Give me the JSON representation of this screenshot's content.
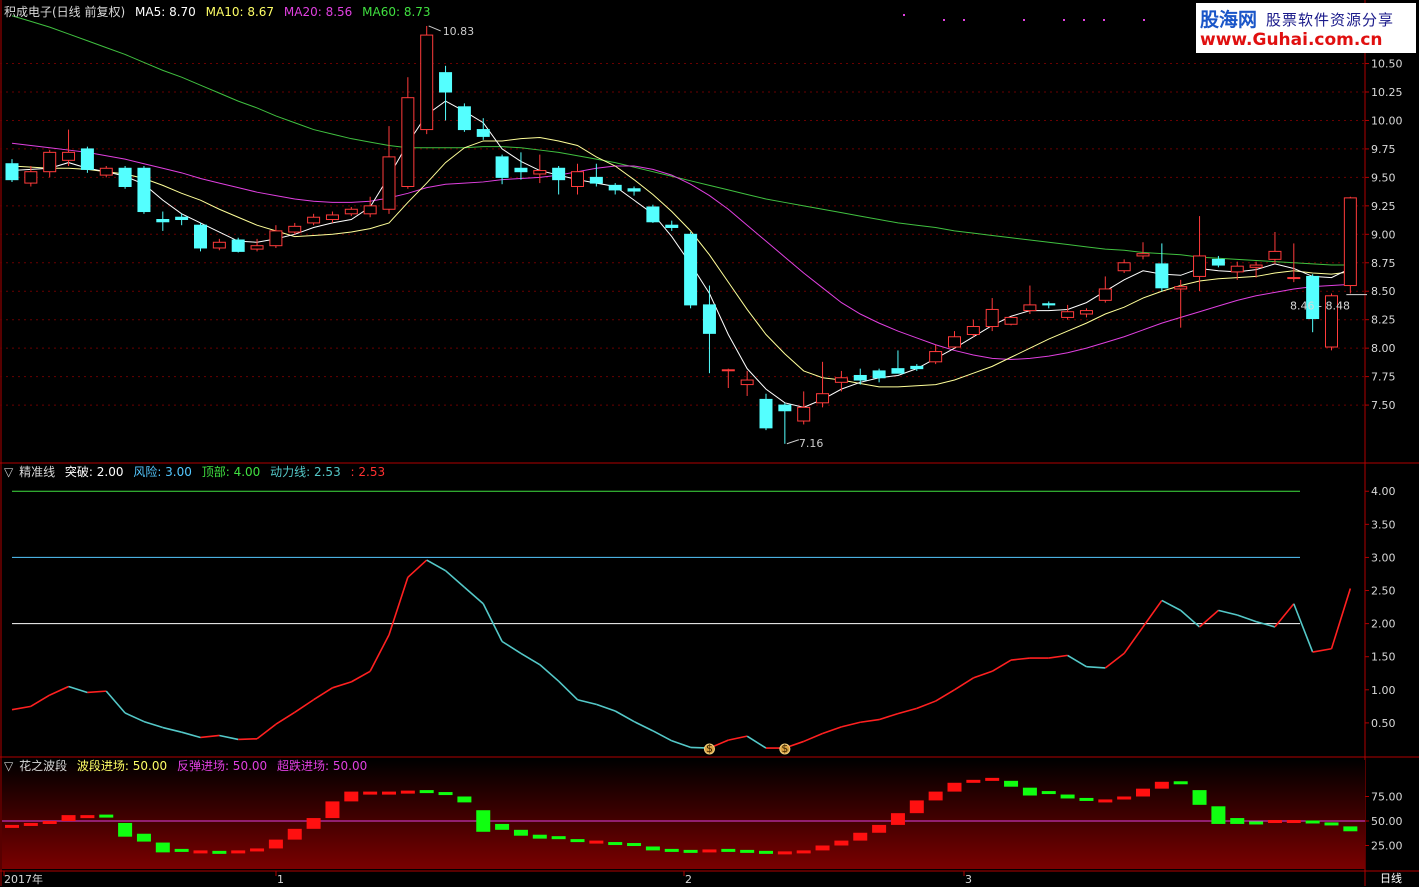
{
  "header": {
    "stock_title": "积成电子(日线 前复权)",
    "ma5_label": "MA5: 8.70",
    "ma10_label": "MA10: 8.67",
    "ma20_label": "MA20: 8.56",
    "ma60_label": "MA60: 8.73",
    "panel_marker": "▽"
  },
  "logo": {
    "line1": "股海网",
    "line1b": "股票软件资源分享",
    "line2": "www.Guhai.com.cn"
  },
  "panel2_header": {
    "name": "精准线",
    "tupo": "突破: 2.00",
    "fengxian": "风险: 3.00",
    "dingbu": "顶部: 4.00",
    "dongli": "动力线: 2.53",
    "extra": ": 2.53"
  },
  "panel3_header": {
    "name": "花之波段",
    "boduan": "波段进场: 50.00",
    "fantan": "反弹进场: 50.00",
    "chaodie": "超跌进场: 50.00"
  },
  "footer": {
    "period_label": "日线"
  },
  "annotations": {
    "high_label": "10.83",
    "low_label": "7.16",
    "price_range": "8.46 - 8.48"
  },
  "colors": {
    "up": "#ff3b3b",
    "down": "#54ffff",
    "ma5": "#ffffff",
    "ma10": "#ffff99",
    "ma20": "#e040e0",
    "ma60": "#40c040",
    "background": "#000000",
    "axis": "#b00000"
  },
  "chart_data": [
    {
      "type": "candlestick",
      "title": "积成电子(日线 前复权)",
      "y_ticks": [
        "10.50",
        "10.25",
        "10.00",
        "9.75",
        "9.50",
        "9.25",
        "9.00",
        "8.75",
        "8.50",
        "8.25",
        "8.00",
        "7.75",
        "7.50"
      ],
      "x_ticks": [
        "2017年",
        "1",
        "2",
        "3"
      ],
      "ylim": [
        7.0,
        10.9
      ],
      "candles": [
        [
          9.62,
          9.48,
          9.66,
          9.46
        ],
        [
          9.45,
          9.55,
          9.6,
          9.42
        ],
        [
          9.55,
          9.72,
          9.74,
          9.5
        ],
        [
          9.65,
          9.72,
          9.92,
          9.6
        ],
        [
          9.75,
          9.57,
          9.77,
          9.54
        ],
        [
          9.52,
          9.58,
          9.6,
          9.5
        ],
        [
          9.58,
          9.42,
          9.6,
          9.4
        ],
        [
          9.58,
          9.2,
          9.6,
          9.18
        ],
        [
          9.13,
          9.11,
          9.2,
          9.03
        ],
        [
          9.15,
          9.13,
          9.18,
          9.08
        ],
        [
          9.08,
          8.88,
          9.1,
          8.85
        ],
        [
          8.88,
          8.93,
          8.96,
          8.86
        ],
        [
          8.95,
          8.85,
          8.97,
          8.84
        ],
        [
          8.87,
          8.9,
          8.96,
          8.85
        ],
        [
          8.9,
          9.03,
          9.08,
          8.88
        ],
        [
          9.02,
          9.07,
          9.1,
          9.0
        ],
        [
          9.1,
          9.15,
          9.18,
          9.08
        ],
        [
          9.13,
          9.17,
          9.2,
          9.1
        ],
        [
          9.18,
          9.22,
          9.24,
          9.16
        ],
        [
          9.18,
          9.25,
          9.33,
          9.15
        ],
        [
          9.22,
          9.68,
          9.95,
          9.18
        ],
        [
          9.42,
          10.2,
          10.38,
          9.4
        ],
        [
          9.92,
          10.75,
          10.83,
          9.88
        ],
        [
          10.42,
          10.25,
          10.48,
          10.0
        ],
        [
          10.12,
          9.92,
          10.15,
          9.9
        ],
        [
          9.92,
          9.86,
          10.02,
          9.83
        ],
        [
          9.68,
          9.5,
          9.7,
          9.44
        ],
        [
          9.58,
          9.55,
          9.72,
          9.48
        ],
        [
          9.53,
          9.56,
          9.7,
          9.45
        ],
        [
          9.58,
          9.48,
          9.6,
          9.35
        ],
        [
          9.42,
          9.55,
          9.62,
          9.35
        ],
        [
          9.5,
          9.45,
          9.62,
          9.42
        ],
        [
          9.43,
          9.39,
          9.45,
          9.35
        ],
        [
          9.4,
          9.38,
          9.42,
          9.34
        ],
        [
          9.24,
          9.11,
          9.26,
          9.1
        ],
        [
          9.08,
          9.06,
          9.12,
          9.03
        ],
        [
          9.0,
          8.38,
          9.02,
          8.35
        ],
        [
          8.38,
          8.13,
          8.55,
          7.78
        ],
        [
          7.81,
          7.81,
          7.82,
          7.65
        ],
        [
          7.68,
          7.72,
          7.8,
          7.58
        ],
        [
          7.55,
          7.3,
          7.6,
          7.28
        ],
        [
          7.5,
          7.45,
          7.52,
          7.16
        ],
        [
          7.36,
          7.48,
          7.62,
          7.33
        ],
        [
          7.52,
          7.6,
          7.88,
          7.48
        ],
        [
          7.7,
          7.74,
          7.8,
          7.62
        ],
        [
          7.76,
          7.72,
          7.82,
          7.68
        ],
        [
          7.8,
          7.74,
          7.82,
          7.7
        ],
        [
          7.82,
          7.78,
          7.98,
          7.8
        ],
        [
          7.84,
          7.82,
          7.86,
          7.8
        ],
        [
          7.88,
          7.97,
          8.03,
          7.86
        ],
        [
          8.01,
          8.1,
          8.15,
          8.0
        ],
        [
          8.12,
          8.19,
          8.25,
          8.1
        ],
        [
          8.19,
          8.34,
          8.44,
          8.15
        ],
        [
          8.21,
          8.27,
          8.27,
          8.2
        ],
        [
          8.33,
          8.38,
          8.55,
          8.3
        ],
        [
          8.39,
          8.38,
          8.41,
          8.35
        ],
        [
          8.27,
          8.32,
          8.38,
          8.25
        ],
        [
          8.3,
          8.33,
          8.35,
          8.27
        ],
        [
          8.42,
          8.52,
          8.63,
          8.4
        ],
        [
          8.68,
          8.75,
          8.78,
          8.66
        ],
        [
          8.81,
          8.83,
          8.93,
          8.78
        ],
        [
          8.74,
          8.53,
          8.92,
          8.5
        ],
        [
          8.52,
          8.54,
          8.6,
          8.18
        ],
        [
          8.63,
          8.81,
          9.16,
          8.5
        ],
        [
          8.78,
          8.73,
          8.81,
          8.71
        ],
        [
          8.67,
          8.72,
          8.76,
          8.6
        ],
        [
          8.71,
          8.73,
          8.76,
          8.62
        ],
        [
          8.78,
          8.85,
          9.02,
          8.74
        ],
        [
          8.62,
          8.62,
          8.92,
          8.58
        ],
        [
          8.63,
          8.26,
          8.65,
          8.14
        ],
        [
          8.01,
          8.46,
          8.48,
          7.98
        ],
        [
          8.55,
          9.32,
          9.33,
          8.48
        ]
      ],
      "series": [
        {
          "name": "MA5",
          "values": [
            9.56,
            9.57,
            9.58,
            9.63,
            9.58,
            9.55,
            9.51,
            9.44,
            9.3,
            9.18,
            9.1,
            9.02,
            8.94,
            8.93,
            8.96,
            9.0,
            9.06,
            9.1,
            9.13,
            9.24,
            9.51,
            9.8,
            10.05,
            10.17,
            10.08,
            9.98,
            9.75,
            9.64,
            9.56,
            9.52,
            9.48,
            9.45,
            9.42,
            9.3,
            9.18,
            8.98,
            8.74,
            8.48,
            8.12,
            7.82,
            7.64,
            7.52,
            7.48,
            7.55,
            7.64,
            7.7,
            7.74,
            7.76,
            7.82,
            7.91,
            8.0,
            8.1,
            8.2,
            8.28,
            8.33,
            8.33,
            8.34,
            8.4,
            8.5,
            8.6,
            8.68,
            8.65,
            8.64,
            8.7,
            8.68,
            8.67,
            8.69,
            8.74,
            8.7,
            8.63,
            8.62,
            8.7
          ]
        },
        {
          "name": "MA10",
          "values": [
            9.6,
            9.59,
            9.58,
            9.58,
            9.57,
            9.55,
            9.53,
            9.49,
            9.43,
            9.36,
            9.3,
            9.22,
            9.15,
            9.08,
            9.03,
            8.98,
            8.99,
            9.0,
            9.02,
            9.05,
            9.1,
            9.28,
            9.45,
            9.63,
            9.76,
            9.82,
            9.82,
            9.84,
            9.85,
            9.82,
            9.78,
            9.68,
            9.6,
            9.48,
            9.35,
            9.2,
            9.03,
            8.82,
            8.58,
            8.34,
            8.12,
            7.95,
            7.8,
            7.74,
            7.72,
            7.69,
            7.66,
            7.66,
            7.67,
            7.68,
            7.72,
            7.78,
            7.84,
            7.92,
            8.0,
            8.08,
            8.15,
            8.22,
            8.3,
            8.36,
            8.44,
            8.5,
            8.55,
            8.59,
            8.61,
            8.62,
            8.63,
            8.66,
            8.68,
            8.66,
            8.65,
            8.67
          ]
        },
        {
          "name": "MA20",
          "values": [
            9.8,
            9.78,
            9.76,
            9.74,
            9.72,
            9.69,
            9.66,
            9.62,
            9.58,
            9.54,
            9.49,
            9.45,
            9.41,
            9.37,
            9.34,
            9.31,
            9.29,
            9.28,
            9.28,
            9.29,
            9.32,
            9.36,
            9.41,
            9.44,
            9.45,
            9.46,
            9.48,
            9.49,
            9.5,
            9.52,
            9.55,
            9.58,
            9.6,
            9.6,
            9.57,
            9.52,
            9.44,
            9.34,
            9.22,
            9.08,
            8.94,
            8.8,
            8.66,
            8.53,
            8.4,
            8.3,
            8.22,
            8.15,
            8.09,
            8.03,
            7.98,
            7.94,
            7.91,
            7.9,
            7.91,
            7.93,
            7.96,
            8.0,
            8.05,
            8.1,
            8.16,
            8.22,
            8.27,
            8.32,
            8.37,
            8.42,
            8.46,
            8.49,
            8.52,
            8.54,
            8.55,
            8.56
          ]
        },
        {
          "name": "MA60",
          "values": [
            10.92,
            10.87,
            10.82,
            10.76,
            10.7,
            10.64,
            10.58,
            10.51,
            10.44,
            10.38,
            10.31,
            10.24,
            10.17,
            10.11,
            10.04,
            9.98,
            9.92,
            9.88,
            9.84,
            9.81,
            9.78,
            9.76,
            9.76,
            9.76,
            9.76,
            9.77,
            9.77,
            9.76,
            9.74,
            9.72,
            9.69,
            9.66,
            9.63,
            9.59,
            9.55,
            9.51,
            9.47,
            9.43,
            9.39,
            9.35,
            9.31,
            9.28,
            9.25,
            9.22,
            9.19,
            9.16,
            9.13,
            9.1,
            9.08,
            9.06,
            9.03,
            9.01,
            8.99,
            8.97,
            8.95,
            8.93,
            8.91,
            8.89,
            8.87,
            8.86,
            8.84,
            8.83,
            8.82,
            8.8,
            8.79,
            8.78,
            8.77,
            8.76,
            8.75,
            8.74,
            8.73,
            8.73
          ]
        }
      ]
    },
    {
      "type": "line",
      "title": "精准线",
      "y_ticks": [
        "4.00",
        "3.50",
        "3.00",
        "2.50",
        "2.00",
        "1.50",
        "1.00",
        "0.50"
      ],
      "ylim": [
        0.0,
        4.2
      ],
      "hlines": [
        {
          "name": "突破",
          "value": 2.0
        },
        {
          "name": "风险",
          "value": 3.0
        },
        {
          "name": "顶部",
          "value": 4.0
        }
      ],
      "series": [
        {
          "name": "动力线",
          "values": [
            0.7,
            0.75,
            0.92,
            1.05,
            0.96,
            0.98,
            0.65,
            0.52,
            0.43,
            0.36,
            0.28,
            0.31,
            0.25,
            0.26,
            0.48,
            0.66,
            0.85,
            1.03,
            1.12,
            1.28,
            1.83,
            2.7,
            2.96,
            2.8,
            2.55,
            2.3,
            1.73,
            1.55,
            1.38,
            1.13,
            0.85,
            0.78,
            0.68,
            0.52,
            0.38,
            0.23,
            0.13,
            0.12,
            0.24,
            0.3,
            0.12,
            0.12,
            0.22,
            0.34,
            0.44,
            0.51,
            0.55,
            0.64,
            0.72,
            0.83,
            1.0,
            1.18,
            1.28,
            1.45,
            1.48,
            1.48,
            1.52,
            1.35,
            1.33,
            1.55,
            1.95,
            2.35,
            2.2,
            1.95,
            2.2,
            2.13,
            2.03,
            1.95,
            2.3,
            1.57,
            1.62,
            2.53
          ]
        }
      ]
    },
    {
      "type": "bar",
      "title": "花之波段",
      "y_ticks": [
        "75.00",
        "50.00",
        "25.00"
      ],
      "ylim": [
        0,
        100
      ],
      "hlines": [
        {
          "name": "波段进场",
          "value": 50.0
        }
      ],
      "series": [
        {
          "name": "花之波段",
          "values": [
            46,
            48,
            50,
            56,
            56,
            55,
            41,
            33,
            23,
            20,
            20,
            18,
            20,
            22,
            31,
            42,
            53,
            70,
            80,
            80,
            80,
            81,
            80,
            78,
            72,
            50,
            44,
            38,
            34,
            33,
            30,
            30,
            27,
            26,
            22,
            20,
            19,
            21,
            20,
            19,
            18,
            19,
            20,
            25,
            30,
            38,
            46,
            58,
            71,
            80,
            89,
            92,
            94,
            88,
            80,
            79,
            75,
            72,
            72,
            75,
            83,
            90,
            89,
            74,
            56,
            50,
            48,
            51,
            51,
            49,
            47,
            42
          ]
        }
      ]
    }
  ]
}
